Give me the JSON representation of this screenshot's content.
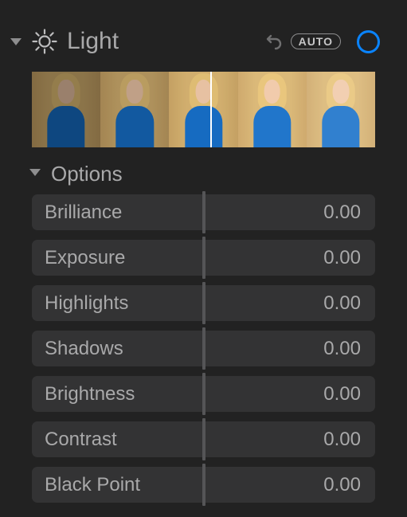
{
  "header": {
    "title": "Light",
    "auto_label": "AUTO"
  },
  "options": {
    "title": "Options"
  },
  "sliders": [
    {
      "label": "Brilliance",
      "value": "0.00"
    },
    {
      "label": "Exposure",
      "value": "0.00"
    },
    {
      "label": "Highlights",
      "value": "0.00"
    },
    {
      "label": "Shadows",
      "value": "0.00"
    },
    {
      "label": "Brightness",
      "value": "0.00"
    },
    {
      "label": "Contrast",
      "value": "0.00"
    },
    {
      "label": "Black Point",
      "value": "0.00"
    }
  ],
  "strip": {
    "brightness_steps": [
      0.55,
      0.75,
      0.95,
      1.1,
      1.25
    ]
  }
}
